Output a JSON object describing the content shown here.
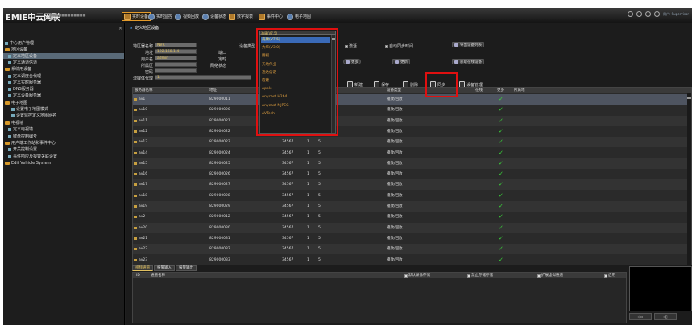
{
  "app": {
    "brand": "EMIE中云网联",
    "brand_sub": "■■■■■■■■■■■■"
  },
  "topbar": {
    "tabs": [
      {
        "label": "实时设备"
      },
      {
        "label": "实时监控"
      },
      {
        "label": "视频回放"
      },
      {
        "label": "设备状态"
      },
      {
        "label": "数字报表"
      },
      {
        "label": "事件中心"
      },
      {
        "label": "电子地图"
      }
    ],
    "user": "用户: Supervisor"
  },
  "sidebar": {
    "items": [
      {
        "label": "中心用户管理",
        "level": 0
      },
      {
        "label": "地区设备",
        "level": 0
      },
      {
        "label": "定义地区设备",
        "level": 1,
        "selected": true
      },
      {
        "label": "定义通道信道",
        "level": 1
      },
      {
        "label": "系统用设备",
        "level": 0
      },
      {
        "label": "定义调度台代理",
        "level": 1
      },
      {
        "label": "定义实时服务器",
        "level": 1
      },
      {
        "label": "DNS服务器",
        "level": 1
      },
      {
        "label": "定义设备服务器",
        "level": 1
      },
      {
        "label": "电子地图",
        "level": 0
      },
      {
        "label": "设置电子地图模式",
        "level": 2
      },
      {
        "label": "设置监控定义地图网名",
        "level": 2
      },
      {
        "label": "电视墙",
        "level": 0
      },
      {
        "label": "定义电视墙",
        "level": 1
      },
      {
        "label": "键盘控制编号",
        "level": 1
      },
      {
        "label": "用户端工作站和事件中心",
        "level": 0
      },
      {
        "label": "开关控制设置",
        "level": 1
      },
      {
        "label": "事件响应及报警关联设置",
        "level": 1
      },
      {
        "label": "Edit Vehicle System",
        "level": 0
      }
    ]
  },
  "main": {
    "page_title": "定义地区设备",
    "form": {
      "name_label": "地区器名称",
      "name_value": "NVR",
      "addr_label": "地址",
      "addr_value": "192.168.1.4",
      "user_label": "用户名",
      "user_value": "admin",
      "area_label": "所属区",
      "area_value": "",
      "pwd_label": "密码",
      "pwd_value": "",
      "proxy_label": "流媒体代理",
      "proxy_value": "1",
      "port_label": "端口",
      "dev_label": "定时",
      "netstat_label": "网络状态",
      "type_label": "设备类型",
      "type_value": "海康(V7.5)"
    },
    "dropdown": {
      "options": [
        "海康(V7.5)",
        "大华(V3.0)",
        "朗视",
        "天地伟业",
        "通达信诺",
        "宏建",
        "Apple",
        "Anycast H264",
        "Anycast MJPEG",
        "AVTech"
      ],
      "selected_index": 0
    },
    "checks": {
      "enable": "激活",
      "auto_sync": "自动同步时间"
    },
    "buttons": {
      "export": "导出设备列表",
      "import": "获取在线设备",
      "more": "更多",
      "config": "更新",
      "add": "新建",
      "save": "保存",
      "delete": "删除",
      "sync": "同步",
      "manage": "设备管理"
    },
    "table": {
      "columns": [
        "服务器名称",
        "地址",
        "",
        "",
        "",
        "设备类型",
        "在线",
        "更多",
        "所属地"
      ],
      "rows": [
        {
          "name": "av1",
          "addr": "829000011",
          "port": "34567",
          "a": "1",
          "b": "5",
          "type": "播放/回放",
          "online": "",
          "more": "✓"
        },
        {
          "name": "av10",
          "addr": "829000020",
          "port": "34567",
          "a": "1",
          "b": "5",
          "type": "播放/回放",
          "online": "",
          "more": "✓"
        },
        {
          "name": "av11",
          "addr": "829000021",
          "port": "34567",
          "a": "1",
          "b": "5",
          "type": "播放/回放",
          "online": "",
          "more": "✓"
        },
        {
          "name": "av12",
          "addr": "829000022",
          "port": "34567",
          "a": "1",
          "b": "5",
          "type": "播放/回放",
          "online": "",
          "more": "✓"
        },
        {
          "name": "av13",
          "addr": "829000023",
          "port": "34567",
          "a": "1",
          "b": "5",
          "type": "播放/回放",
          "online": "",
          "more": "✓"
        },
        {
          "name": "av14",
          "addr": "829000024",
          "port": "34567",
          "a": "1",
          "b": "5",
          "type": "播放/回放",
          "online": "",
          "more": "✓"
        },
        {
          "name": "av15",
          "addr": "829000025",
          "port": "34567",
          "a": "1",
          "b": "5",
          "type": "播放/回放",
          "online": "",
          "more": "✓"
        },
        {
          "name": "av16",
          "addr": "829000026",
          "port": "34567",
          "a": "1",
          "b": "5",
          "type": "播放/回放",
          "online": "",
          "more": "✓"
        },
        {
          "name": "av17",
          "addr": "829000027",
          "port": "34567",
          "a": "1",
          "b": "5",
          "type": "播放/回放",
          "online": "",
          "more": "✓"
        },
        {
          "name": "av18",
          "addr": "829000028",
          "port": "34567",
          "a": "1",
          "b": "5",
          "type": "播放/回放",
          "online": "",
          "more": "✓"
        },
        {
          "name": "av19",
          "addr": "829000029",
          "port": "34567",
          "a": "1",
          "b": "5",
          "type": "播放/回放",
          "online": "",
          "more": "✓"
        },
        {
          "name": "av2",
          "addr": "829000012",
          "port": "34567",
          "a": "1",
          "b": "5",
          "type": "播放/回放",
          "online": "",
          "more": "✓"
        },
        {
          "name": "av20",
          "addr": "829000030",
          "port": "34567",
          "a": "1",
          "b": "5",
          "type": "播放/回放",
          "online": "",
          "more": "✓"
        },
        {
          "name": "av21",
          "addr": "829000031",
          "port": "34567",
          "a": "1",
          "b": "5",
          "type": "播放/回放",
          "online": "",
          "more": "✓"
        },
        {
          "name": "av22",
          "addr": "829000032",
          "port": "34567",
          "a": "1",
          "b": "5",
          "type": "播放/回放",
          "online": "",
          "more": "✓"
        },
        {
          "name": "av23",
          "addr": "829000033",
          "port": "34567",
          "a": "1",
          "b": "5",
          "type": "播放/回放",
          "online": "",
          "more": "✓"
        }
      ]
    },
    "bottom": {
      "tabs": [
        "视频通道",
        "报警输入",
        "报警输出"
      ],
      "columns": [
        "ID",
        "通道名称",
        "默认录像存储",
        "禁止存储存储",
        "扩展虚拟通道",
        "启用"
      ],
      "preview_buttons": [
        "◁▭",
        "◁▯"
      ]
    }
  },
  "colors": {
    "accent": "#e39a2a",
    "highlight_box": "#e01010",
    "check": "#3ad83a",
    "selected_row": "#4e5460"
  }
}
